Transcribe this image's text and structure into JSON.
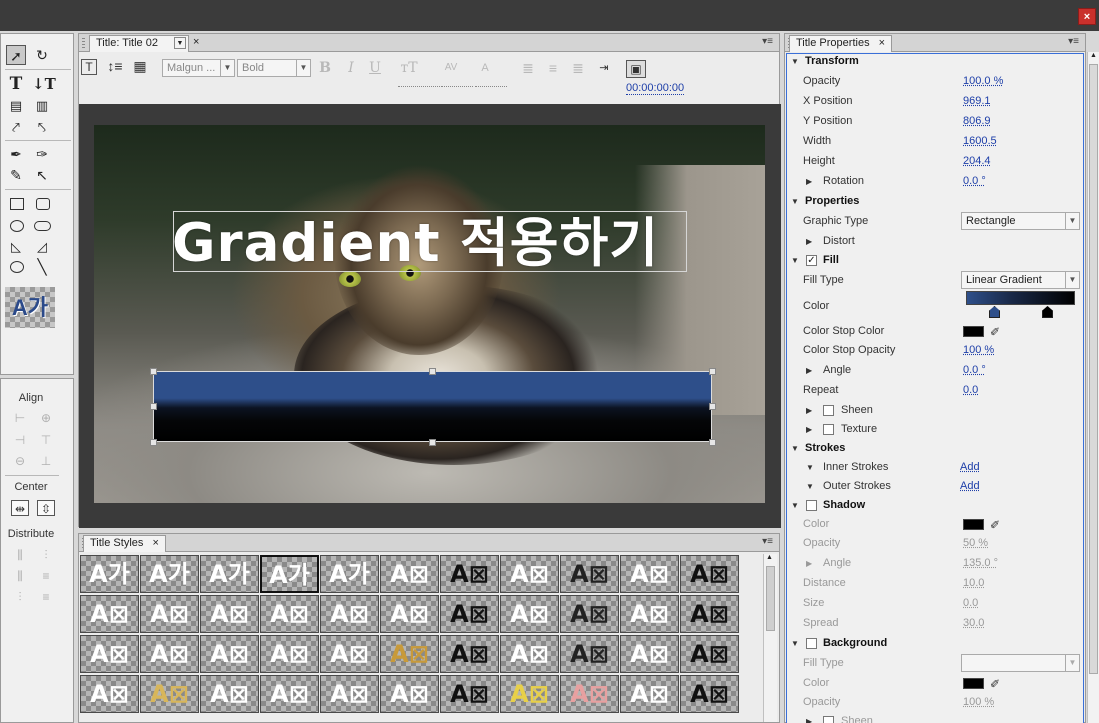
{
  "window": {
    "close_label": "×"
  },
  "title_panel": {
    "tab_label": "Title: Title 02",
    "tab_close": "×",
    "font_family": "Malgun ...",
    "font_style": "Bold",
    "timecode": "00:00:00:00"
  },
  "canvas": {
    "title_text": "Gradient 적용하기"
  },
  "align_panel": {
    "align_label": "Align",
    "center_label": "Center",
    "distribute_label": "Distribute"
  },
  "styles_panel": {
    "tab_label": "Title Styles",
    "tab_close": "×",
    "rows": [
      [
        "A가",
        "A가",
        "A가",
        "A가",
        "A가",
        "A⊠",
        "A⊠",
        "A⊠",
        "A⊠",
        "A⊠",
        "A⊠"
      ],
      [
        "A⊠",
        "A⊠",
        "A⊠",
        "A⊠",
        "A⊠",
        "A⊠",
        "A⊠",
        "A⊠",
        "A⊠",
        "A⊠",
        "A⊠"
      ],
      [
        "A⊠",
        "A⊠",
        "A⊠",
        "A⊠",
        "A⊠",
        "A⊠",
        "A⊠",
        "A⊠",
        "A⊠",
        "A⊠",
        "A⊠"
      ],
      [
        "A⊠",
        "A⊠",
        "A⊠",
        "A⊠",
        "A⊠",
        "A⊠",
        "A⊠",
        "A⊠",
        "A⊠",
        "A⊠",
        "A⊠"
      ]
    ],
    "preview_label": "A가"
  },
  "props_panel": {
    "tab_label": "Title Properties",
    "tab_close": "×",
    "transform_header": "Transform",
    "opacity_label": "Opacity",
    "opacity_value": "100.0 %",
    "xpos_label": "X Position",
    "xpos_value": "969.1",
    "ypos_label": "Y Position",
    "ypos_value": "806.9",
    "width_label": "Width",
    "width_value": "1600.5",
    "height_label": "Height",
    "height_value": "204.4",
    "rotation_label": "Rotation",
    "rotation_value": "0.0 °",
    "properties_header": "Properties",
    "graphic_type_label": "Graphic Type",
    "graphic_type_value": "Rectangle",
    "distort_label": "Distort",
    "fill_header": "Fill",
    "fill_type_label": "Fill Type",
    "fill_type_value": "Linear Gradient",
    "color_label": "Color",
    "stop_color_label": "Color Stop Color",
    "stop_opacity_label": "Color Stop Opacity",
    "stop_opacity_value": "100 %",
    "angle_label": "Angle",
    "angle_value": "0.0 °",
    "repeat_label": "Repeat",
    "repeat_value": "0.0",
    "sheen_label": "Sheen",
    "texture_label": "Texture",
    "strokes_header": "Strokes",
    "inner_strokes_label": "Inner Strokes",
    "inner_strokes_add": "Add",
    "outer_strokes_label": "Outer Strokes",
    "outer_strokes_add": "Add",
    "shadow_header": "Shadow",
    "sh_color_label": "Color",
    "sh_opacity_label": "Opacity",
    "sh_opacity_value": "50 %",
    "sh_angle_label": "Angle",
    "sh_angle_value": "135.0 °",
    "sh_distance_label": "Distance",
    "sh_distance_value": "10.0",
    "sh_size_label": "Size",
    "sh_size_value": "0.0",
    "sh_spread_label": "Spread",
    "sh_spread_value": "30.0",
    "background_header": "Background",
    "bg_fill_type_label": "Fill Type",
    "bg_color_label": "Color",
    "bg_opacity_label": "Opacity",
    "bg_opacity_value": "100 %",
    "bg_sheen_label": "Sheen"
  },
  "colors": {
    "gradient_start": "#2e4f8a",
    "gradient_end": "#000000",
    "accent_link": "#1d3ea8",
    "close_button": "#c9302c"
  }
}
